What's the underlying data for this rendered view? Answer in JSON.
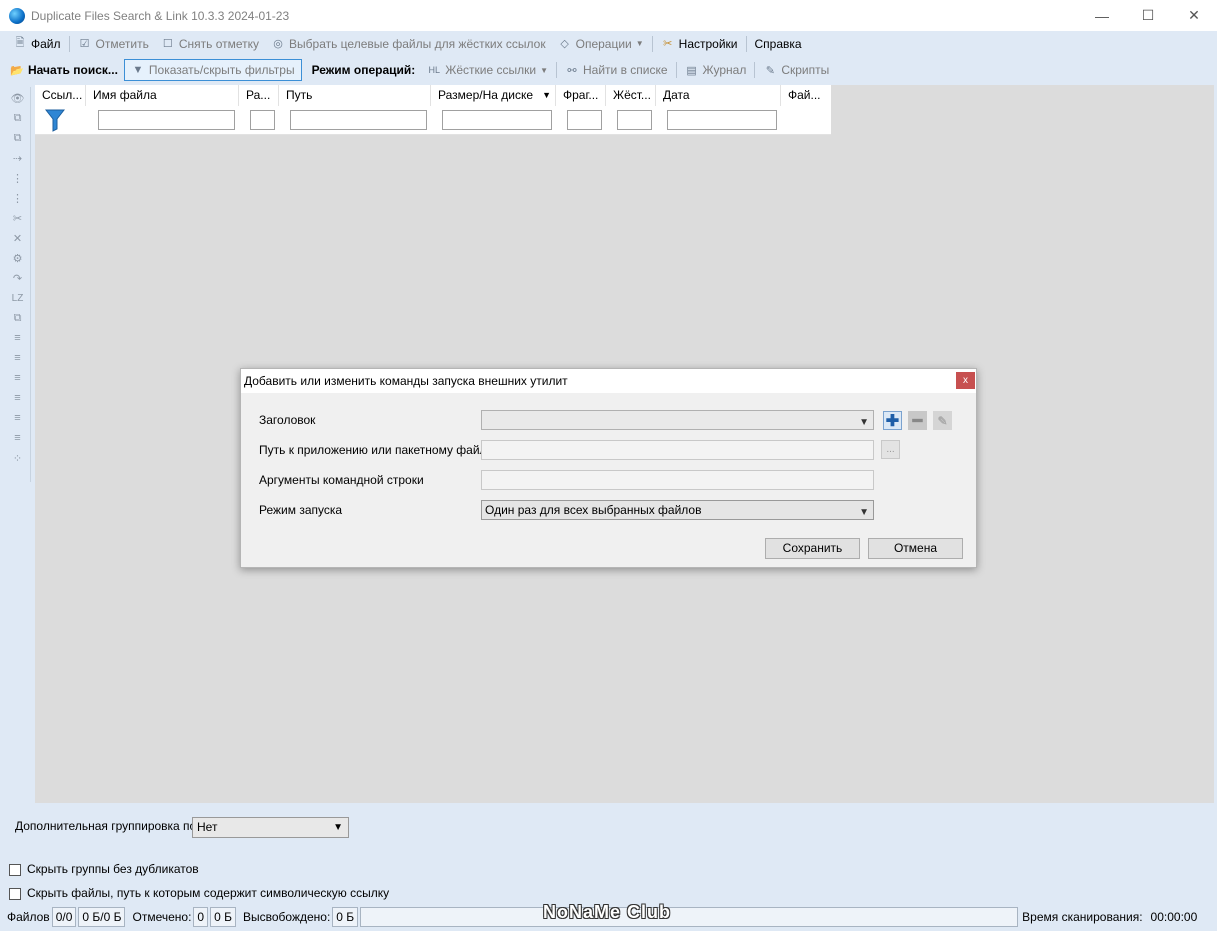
{
  "window": {
    "title": "Duplicate Files Search & Link 10.3.3 2024-01-23"
  },
  "menu": [
    {
      "label": "Файл",
      "icon": "file-icon",
      "disabled": false
    },
    {
      "label": "Отметить",
      "icon": "check-icon",
      "disabled": true
    },
    {
      "label": "Снять отметку",
      "icon": "uncheck-icon",
      "disabled": true
    },
    {
      "label": "Выбрать целевые файлы для жёстких ссылок",
      "icon": "target-icon",
      "disabled": true
    },
    {
      "label": "Операции",
      "icon": "operations-icon",
      "disabled": true
    },
    {
      "label": "Настройки",
      "icon": "settings-icon",
      "disabled": false
    },
    {
      "label": "Справка",
      "icon": "",
      "disabled": false
    }
  ],
  "toolbar": {
    "start_search": "Начать поиск...",
    "toggle_filters": "Показать/скрыть фильтры",
    "operation_mode_label": "Режим операций:",
    "hardlinks": "Жёсткие ссылки",
    "find_in_list": "Найти в списке",
    "journal": "Журнал",
    "scripts": "Скрипты"
  },
  "grid": {
    "columns": [
      "Ссыл...",
      "Имя файла",
      "Ра...",
      "Путь",
      "Размер/На диске",
      "Фраг...",
      "Жёст...",
      "Дата",
      "Фай..."
    ]
  },
  "left_strip": {
    "lz_label": "LZ"
  },
  "dialog": {
    "title": "Добавить или изменить команды запуска внешних утилит",
    "close": "x",
    "fields": {
      "header_label": "Заголовок",
      "header_value": "",
      "path_label": "Путь к приложению или пакетному файлу",
      "path_value": "",
      "args_label": "Аргументы командной строки",
      "args_value": "",
      "mode_label": "Режим запуска",
      "mode_value": "Один раз для всех выбранных файлов"
    },
    "browse": "...",
    "save": "Сохранить",
    "cancel": "Отмена"
  },
  "bottom": {
    "grouping_label": "Дополнительная группировка по",
    "grouping_value": "Нет",
    "hide_groups": "Скрыть группы без дубликатов",
    "hide_symlinks": "Скрыть файлы, путь к которым содержит символическую ссылку"
  },
  "status": {
    "files_label": "Файлов",
    "files_count": "0/0",
    "files_size": "0 Б/0 Б",
    "marked_label": "Отмечено:",
    "marked_count": "0",
    "marked_size": "0 Б",
    "freed_label": "Высвобождено:",
    "freed_size": "0 Б",
    "scan_time_label": "Время сканирования:",
    "scan_time": "00:00:00"
  },
  "watermark": "NoNaMe Club"
}
